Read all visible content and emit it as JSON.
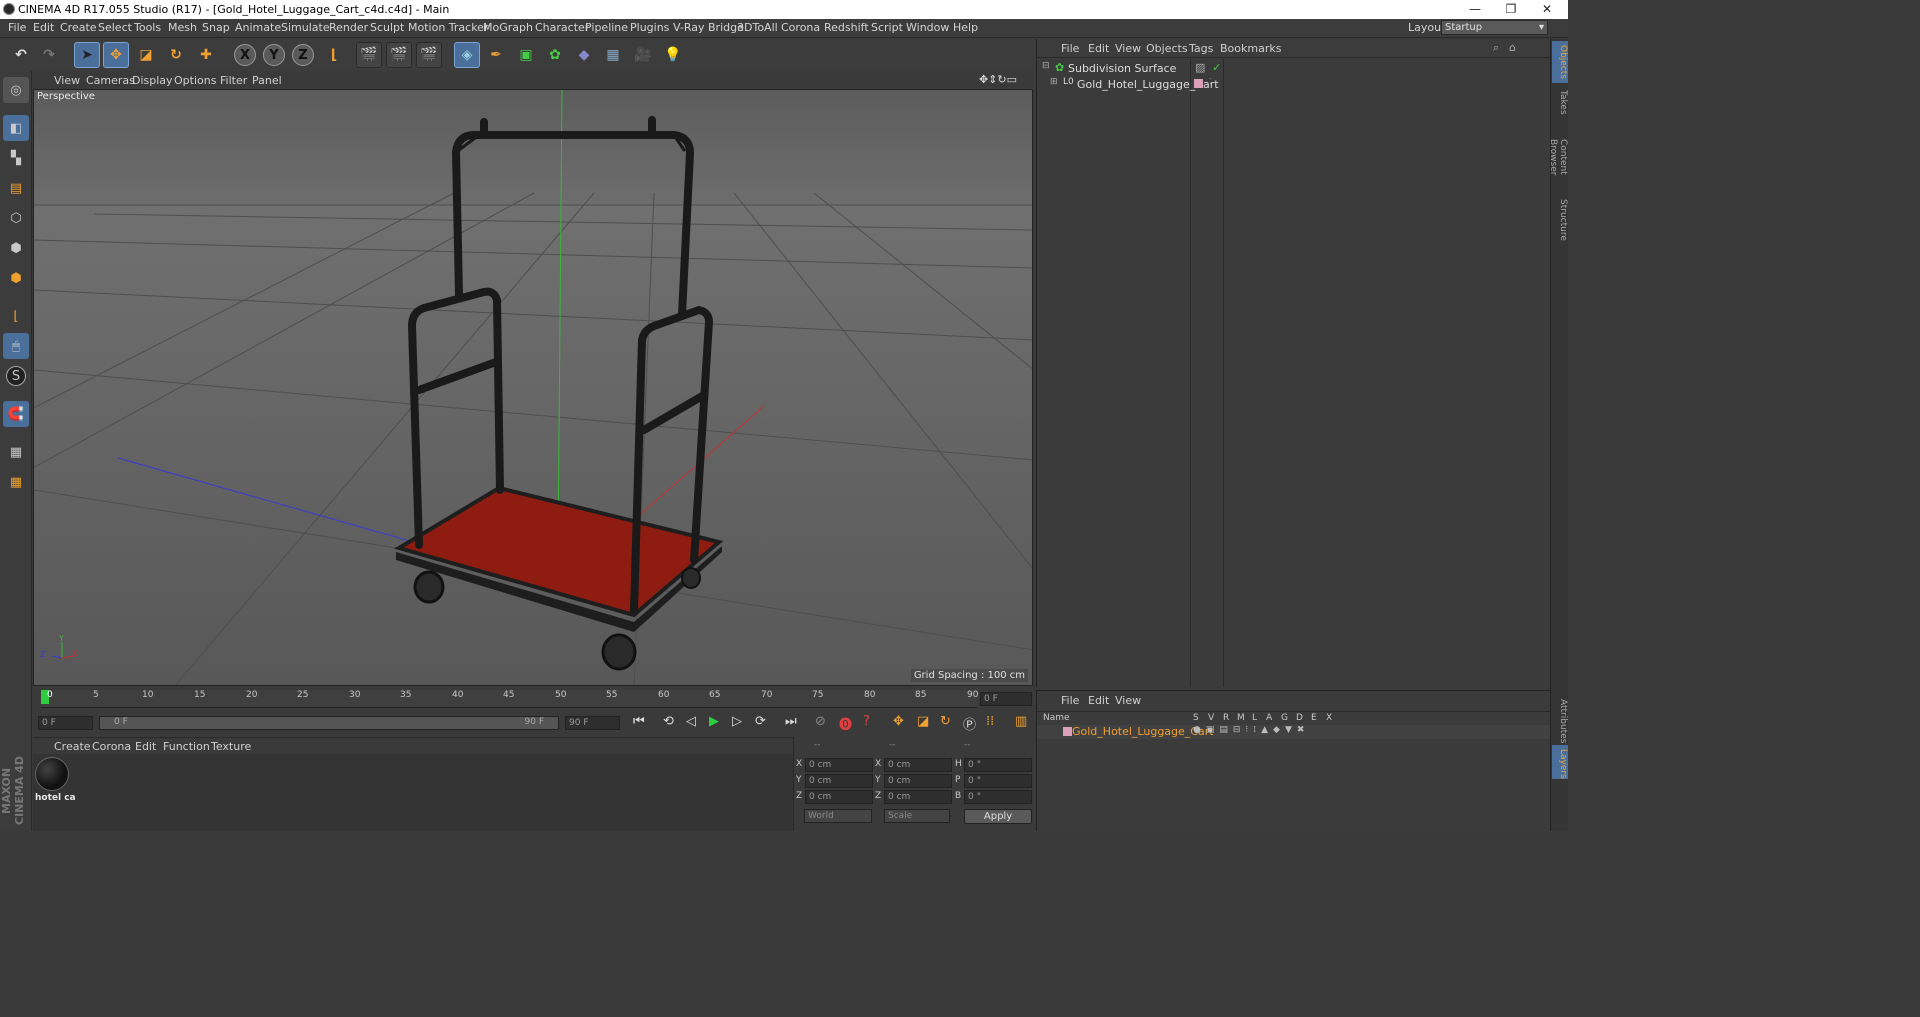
{
  "window": {
    "title": "CINEMA 4D R17.055 Studio (R17) - [Gold_Hotel_Luggage_Cart_c4d.c4d] - Main",
    "minimize": "—",
    "restore": "❐",
    "close": "✕"
  },
  "menu": [
    "File",
    "Edit",
    "Create",
    "Select",
    "Tools",
    "Mesh",
    "Snap",
    "Animate",
    "Simulate",
    "Render",
    "Sculpt",
    "Motion Tracker",
    "MoGraph",
    "Character",
    "Pipeline",
    "Plugins",
    "V-Ray Bridge",
    "3DToAll",
    "Corona",
    "Redshift",
    "Script",
    "Window",
    "Help"
  ],
  "layout": {
    "label": "Layout:",
    "value": "Startup"
  },
  "viewport": {
    "menu": [
      "View",
      "Cameras",
      "Display",
      "Options",
      "Filter",
      "Panel"
    ],
    "camera_label": "Perspective",
    "grid_spacing": "Grid Spacing : 100 cm"
  },
  "timeline": {
    "ticks": [
      "0",
      "5",
      "10",
      "15",
      "20",
      "25",
      "30",
      "35",
      "40",
      "45",
      "50",
      "55",
      "60",
      "65",
      "70",
      "75",
      "80",
      "85",
      "90"
    ],
    "frame_end_field": "0 F",
    "current_frame": "0 F",
    "range_start": "0 F",
    "range_end": "90 F",
    "max_frame": "90 F"
  },
  "material_panel": {
    "menu": [
      "Create",
      "Corona",
      "Edit",
      "Function",
      "Texture"
    ],
    "material_name": "hotel ca"
  },
  "coordinates": {
    "headers": [
      "--",
      "--",
      "--"
    ],
    "rows": [
      {
        "a": "X",
        "av": "0 cm",
        "b": "X",
        "bv": "0 cm",
        "c": "H",
        "cv": "0 °"
      },
      {
        "a": "Y",
        "av": "0 cm",
        "b": "Y",
        "bv": "0 cm",
        "c": "P",
        "cv": "0 °"
      },
      {
        "a": "Z",
        "av": "0 cm",
        "b": "Z",
        "bv": "0 cm",
        "c": "B",
        "cv": "0 °"
      }
    ],
    "mode1": "World",
    "mode2": "Scale",
    "apply": "Apply"
  },
  "object_manager": {
    "menu": [
      "File",
      "Edit",
      "View",
      "Objects",
      "Tags",
      "Bookmarks"
    ],
    "objects": [
      {
        "name": "Subdivision Surface"
      },
      {
        "name": "Gold_Hotel_Luggage_Cart"
      }
    ]
  },
  "layer_manager": {
    "menu": [
      "File",
      "Edit",
      "View"
    ],
    "columns": [
      "Name",
      "S",
      "V",
      "R",
      "M",
      "L",
      "A",
      "G",
      "D",
      "E",
      "X"
    ],
    "layer_name": "Gold_Hotel_Luggage_Cart"
  },
  "side_tabs": [
    "Objects",
    "Takes",
    "Content Browser",
    "Structure"
  ],
  "side_tabs_bottom": [
    "Attributes",
    "Layers"
  ],
  "brand": "MAXON CINEMA 4D",
  "colors": {
    "accent_orange": "#f0a030",
    "accent_blue": "#4b6f9b",
    "cart_base": "#8e1c10"
  }
}
